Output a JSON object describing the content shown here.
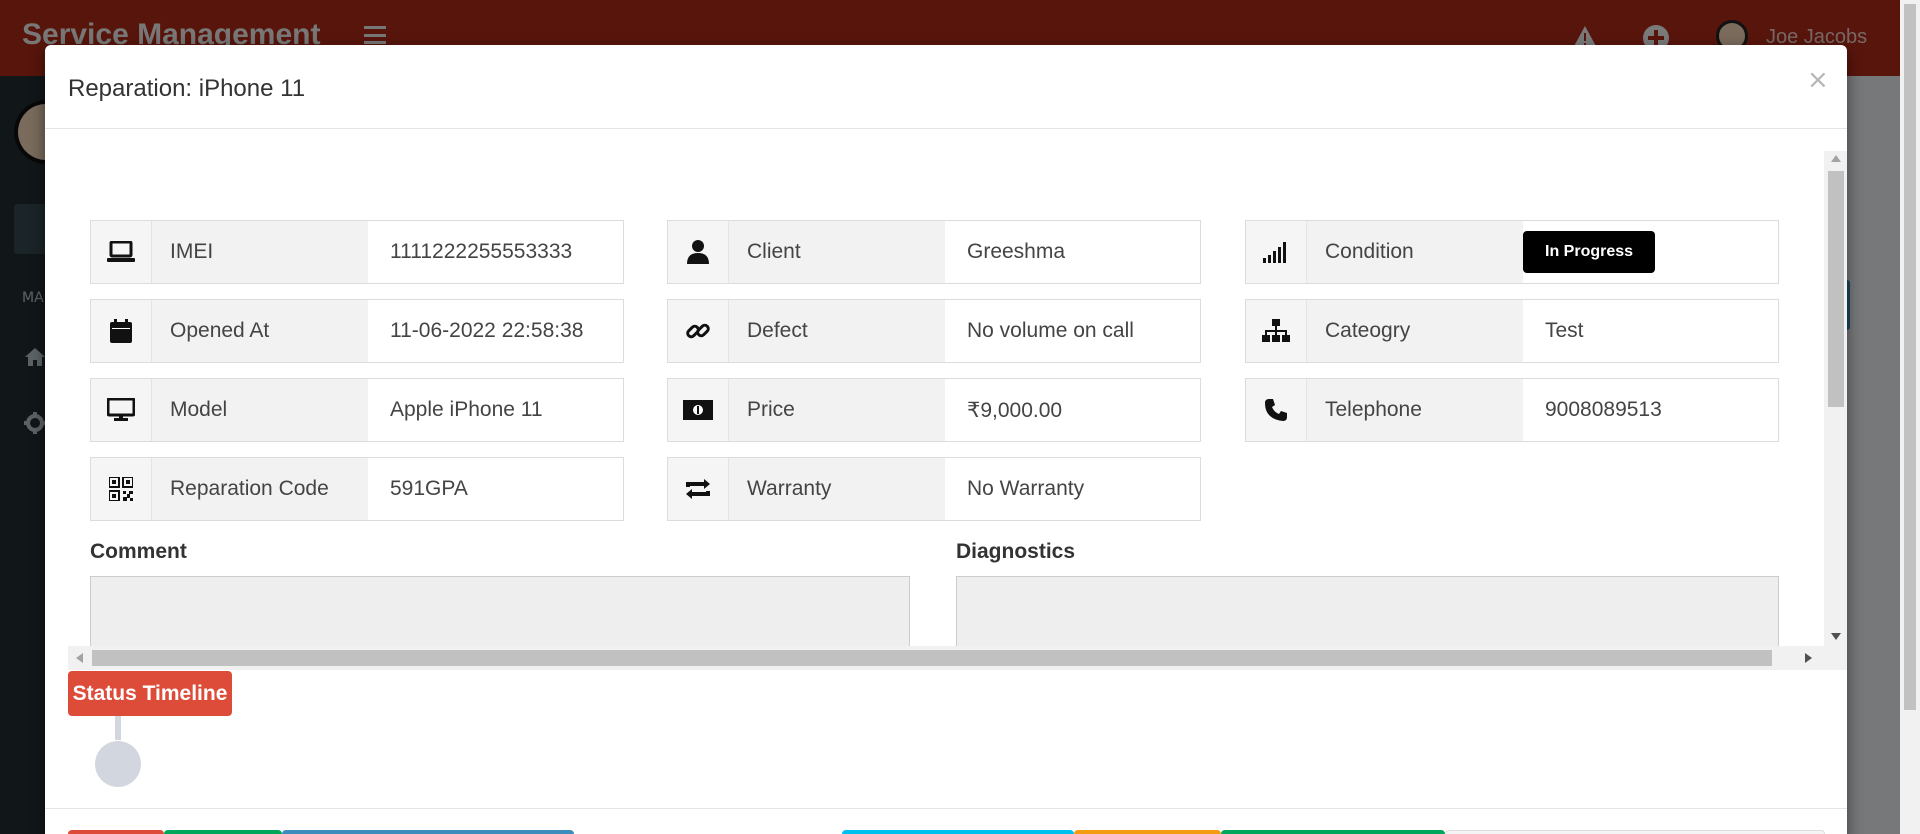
{
  "app": {
    "brand": "Service Management",
    "user_name": "Joe Jacobs",
    "sidebar_section": "MA"
  },
  "modal": {
    "title": "Reparation: iPhone 11",
    "close": "×",
    "fields": [
      {
        "icon": "laptop-icon",
        "label": "IMEI",
        "value": "1111222255553333"
      },
      {
        "icon": "user-icon",
        "label": "Client",
        "value": "Greeshma"
      },
      {
        "icon": "signal-icon",
        "label": "Condition",
        "value": "In Progress"
      },
      {
        "icon": "calendar-icon",
        "label": "Opened At",
        "value": "11-06-2022 22:58:38"
      },
      {
        "icon": "link-icon",
        "label": "Defect",
        "value": "No volume on call"
      },
      {
        "icon": "sitemap-icon",
        "label": "Cateogry",
        "value": "Test"
      },
      {
        "icon": "desktop-icon",
        "label": "Model",
        "value": "Apple iPhone 11"
      },
      {
        "icon": "money-icon",
        "label": "Price",
        "value": "₹9,000.00"
      },
      {
        "icon": "phone-icon",
        "label": "Telephone",
        "value": "9008089513"
      },
      {
        "icon": "qrcode-icon",
        "label": "Reparation Code",
        "value": "591GPA"
      },
      {
        "icon": "retweet-icon",
        "label": "Warranty",
        "value": "No Warranty"
      }
    ],
    "comment_label": "Comment",
    "comment_value": "",
    "diagnostics_label": "Diagnostics",
    "diagnostics_value": "",
    "timeline_label": "Status Timeline"
  },
  "colors": {
    "header": "#b02a18",
    "timeline": "#dd4b39",
    "badge": "#000000"
  }
}
